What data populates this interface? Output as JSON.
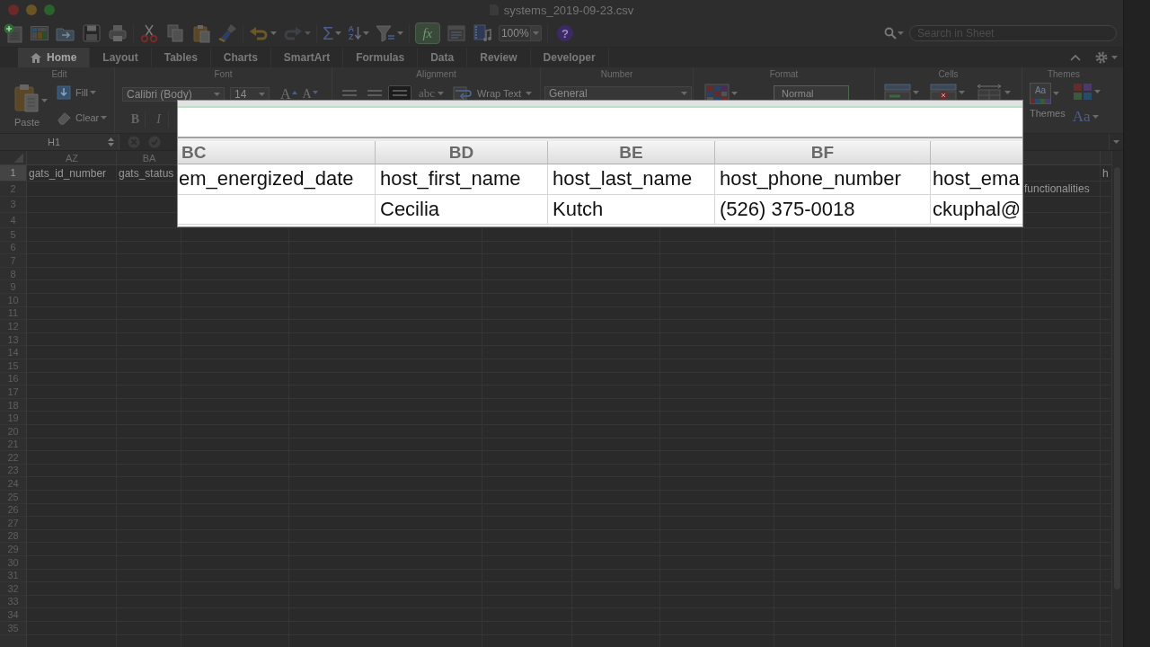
{
  "window": {
    "title": "systems_2019-09-23.csv"
  },
  "toolbar": {
    "redo_disabled": true,
    "autosum": "Σ",
    "sort": [
      "A",
      "Z"
    ],
    "formula_builder": {
      "label": "fx",
      "active": true
    },
    "zoom": "100%",
    "help": "?"
  },
  "search": {
    "placeholder": "Search in Sheet"
  },
  "ribbon": {
    "tabs": [
      {
        "label": "Home",
        "selected": true
      },
      {
        "label": "Layout",
        "selected": false
      },
      {
        "label": "Tables",
        "selected": false
      },
      {
        "label": "Charts",
        "selected": false
      },
      {
        "label": "SmartArt",
        "selected": false
      },
      {
        "label": "Formulas",
        "selected": false
      },
      {
        "label": "Data",
        "selected": false
      },
      {
        "label": "Review",
        "selected": false
      },
      {
        "label": "Developer",
        "selected": false
      }
    ],
    "groups": [
      {
        "kind": "edit",
        "label": "Edit",
        "paste": "Paste",
        "fill": "Fill",
        "clear": "Clear"
      },
      {
        "kind": "font",
        "label": "Font",
        "font_name": "Calibri (Body)",
        "font_size": "14",
        "grow": "A",
        "shrink": "A",
        "bold": "B",
        "italic": "I"
      },
      {
        "kind": "alignment",
        "label": "Alignment",
        "align_buttons": [
          {
            "selected": false
          },
          {
            "selected": false
          },
          {
            "selected": true
          }
        ],
        "orientation": "abc",
        "wrap": "Wrap Text"
      },
      {
        "kind": "number",
        "label": "Number",
        "format": "General"
      },
      {
        "kind": "format",
        "label": "Format",
        "style": "Normal"
      },
      {
        "kind": "cells",
        "label": "Cells"
      },
      {
        "kind": "themes",
        "label": "Themes",
        "preview": "Aa",
        "button": "Themes",
        "fonts": "Aa"
      }
    ]
  },
  "formula_bar": {
    "name_box": "H1"
  },
  "sheet": {
    "column_headers": [
      "AZ",
      "BA"
    ],
    "rows": [
      {
        "number": "1",
        "selected": true,
        "cells": {
          "column_1": "gats_id_number",
          "column_2": "gats_status",
          "column_11": "h"
        }
      },
      {
        "number": "2",
        "selected": false,
        "cells": {
          "column_10": "functionalities"
        }
      },
      {
        "number": "3",
        "selected": false
      },
      {
        "number": "4",
        "selected": false
      },
      {
        "number": "5",
        "selected": false
      },
      {
        "number": "6",
        "selected": false
      },
      {
        "number": "7",
        "selected": false
      },
      {
        "number": "8",
        "selected": false
      },
      {
        "number": "9",
        "selected": false
      },
      {
        "number": "10",
        "selected": false
      },
      {
        "number": "11",
        "selected": false
      },
      {
        "number": "12",
        "selected": false
      },
      {
        "number": "13",
        "selected": false
      },
      {
        "number": "14",
        "selected": false
      },
      {
        "number": "15",
        "selected": false
      },
      {
        "number": "16",
        "selected": false
      },
      {
        "number": "17",
        "selected": false
      },
      {
        "number": "18",
        "selected": false
      },
      {
        "number": "19",
        "selected": false
      },
      {
        "number": "20",
        "selected": false
      },
      {
        "number": "21",
        "selected": false
      },
      {
        "number": "22",
        "selected": false
      },
      {
        "number": "23",
        "selected": false
      },
      {
        "number": "24",
        "selected": false
      },
      {
        "number": "25",
        "selected": false
      },
      {
        "number": "26",
        "selected": false
      },
      {
        "number": "27",
        "selected": false
      },
      {
        "number": "28",
        "selected": false
      },
      {
        "number": "29",
        "selected": false
      },
      {
        "number": "30",
        "selected": false
      },
      {
        "number": "31",
        "selected": false
      },
      {
        "number": "32",
        "selected": false
      },
      {
        "number": "33",
        "selected": false
      },
      {
        "number": "34",
        "selected": false
      },
      {
        "number": "35",
        "selected": false
      }
    ]
  },
  "magnifier": {
    "column_headers": [
      "BC",
      "BD",
      "BE",
      "BF"
    ],
    "rows": [
      {
        "column_1": "em_energized_date",
        "column_2": "host_first_name",
        "column_3": "host_last_name",
        "column_4": "host_phone_number",
        "column_5": "host_ema"
      },
      {
        "column_2": "Cecilia",
        "column_3": "Kutch",
        "column_4": "(526) 375-0018",
        "column_5": "ckuphal@"
      }
    ]
  }
}
